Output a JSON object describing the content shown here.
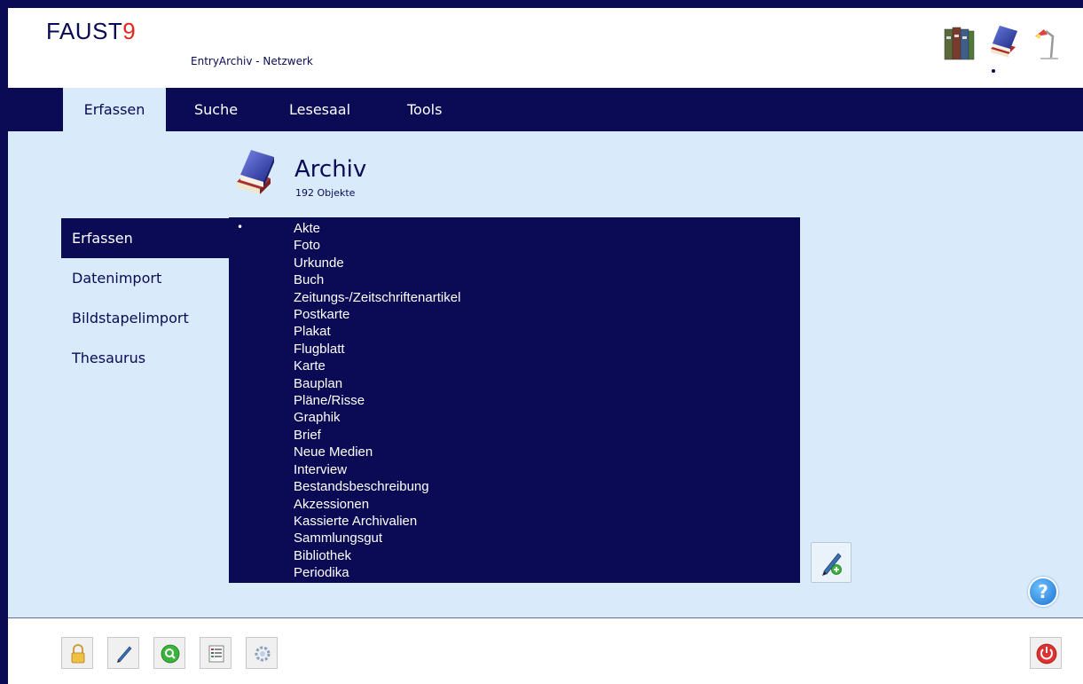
{
  "header": {
    "logo_text": "FAUST",
    "logo_suffix": "9",
    "app_title": "EntryArchiv - Netzwerk",
    "icons": [
      "binders-icon",
      "books-icon",
      "desk-lamp-icon"
    ]
  },
  "nav": {
    "tabs": [
      {
        "label": "Erfassen",
        "active": true
      },
      {
        "label": "Suche",
        "active": false
      },
      {
        "label": "Lesesaal",
        "active": false
      },
      {
        "label": "Tools",
        "active": false
      }
    ]
  },
  "archive": {
    "title": "Archiv",
    "count_label": "192 Objekte",
    "icon": "books-icon"
  },
  "sidebar": {
    "items": [
      {
        "label": "Erfassen",
        "active": true
      },
      {
        "label": "Datenimport",
        "active": false
      },
      {
        "label": "Bildstapelimport",
        "active": false
      },
      {
        "label": "Thesaurus",
        "active": false
      }
    ]
  },
  "typelist": {
    "bullet": "•",
    "items": [
      "Akte",
      "Foto",
      "Urkunde",
      "Buch",
      "Zeitungs-/Zeitschriftenartikel",
      "Postkarte",
      "Plakat",
      "Flugblatt",
      "Karte",
      "Bauplan",
      "Pläne/Risse",
      "Graphik",
      "Brief",
      "Neue Medien",
      "Interview",
      "Bestandsbeschreibung",
      "Akzessionen",
      "Kassierte Archivalien",
      "Sammlungsgut",
      "Bibliothek",
      "Periodika"
    ]
  },
  "buttons": {
    "edit": "pen-add-icon",
    "help": "?",
    "footer": [
      "lock-icon",
      "pen-icon",
      "search-icon",
      "list-icon",
      "gear-icon"
    ],
    "power": "power-icon"
  },
  "colors": {
    "navy": "#0a0a55",
    "panel": "#d9ebfb",
    "logo_accent": "#e3261c"
  }
}
